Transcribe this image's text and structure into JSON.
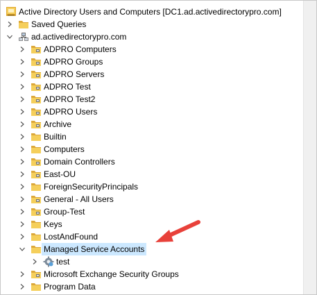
{
  "tree": {
    "rows": [
      {
        "label": "Active Directory Users and Computers [DC1.ad.activedirectorypro.com]",
        "level": 0,
        "chevron": "none",
        "icon": "aduc-console-icon"
      },
      {
        "label": "Saved Queries",
        "level": 1,
        "chevron": "right",
        "icon": "folder-icon"
      },
      {
        "label": "ad.activedirectorypro.com",
        "level": 1,
        "chevron": "down",
        "icon": "domain-icon"
      },
      {
        "label": "ADPRO Computers",
        "level": 2,
        "chevron": "right",
        "icon": "ou-icon"
      },
      {
        "label": "ADPRO Groups",
        "level": 2,
        "chevron": "right",
        "icon": "ou-icon"
      },
      {
        "label": "ADPRO Servers",
        "level": 2,
        "chevron": "right",
        "icon": "ou-icon"
      },
      {
        "label": "ADPRO Test",
        "level": 2,
        "chevron": "right",
        "icon": "ou-icon"
      },
      {
        "label": "ADPRO Test2",
        "level": 2,
        "chevron": "right",
        "icon": "ou-icon"
      },
      {
        "label": "ADPRO Users",
        "level": 2,
        "chevron": "right",
        "icon": "ou-icon"
      },
      {
        "label": "Archive",
        "level": 2,
        "chevron": "right",
        "icon": "ou-icon"
      },
      {
        "label": "Builtin",
        "level": 2,
        "chevron": "right",
        "icon": "folder-icon"
      },
      {
        "label": "Computers",
        "level": 2,
        "chevron": "right",
        "icon": "folder-icon"
      },
      {
        "label": "Domain Controllers",
        "level": 2,
        "chevron": "right",
        "icon": "ou-icon"
      },
      {
        "label": "East-OU",
        "level": 2,
        "chevron": "right",
        "icon": "ou-icon"
      },
      {
        "label": "ForeignSecurityPrincipals",
        "level": 2,
        "chevron": "right",
        "icon": "folder-icon"
      },
      {
        "label": "General - All Users",
        "level": 2,
        "chevron": "right",
        "icon": "ou-icon"
      },
      {
        "label": "Group-Test",
        "level": 2,
        "chevron": "right",
        "icon": "ou-icon"
      },
      {
        "label": "Keys",
        "level": 2,
        "chevron": "right",
        "icon": "folder-icon"
      },
      {
        "label": "LostAndFound",
        "level": 2,
        "chevron": "right",
        "icon": "folder-icon"
      },
      {
        "label": "Managed Service Accounts",
        "level": 2,
        "chevron": "down",
        "icon": "folder-icon",
        "selected": true
      },
      {
        "label": "test",
        "level": 3,
        "chevron": "right",
        "icon": "service-account-icon"
      },
      {
        "label": "Microsoft Exchange Security Groups",
        "level": 2,
        "chevron": "right",
        "icon": "ou-icon"
      },
      {
        "label": "Program Data",
        "level": 2,
        "chevron": "right",
        "icon": "folder-icon"
      }
    ]
  },
  "colors": {
    "folder": "#f5cf5b",
    "folder_dark": "#dca83a",
    "selection": "#cce8ff",
    "arrow": "#e8413a",
    "chevron": "#555555"
  }
}
